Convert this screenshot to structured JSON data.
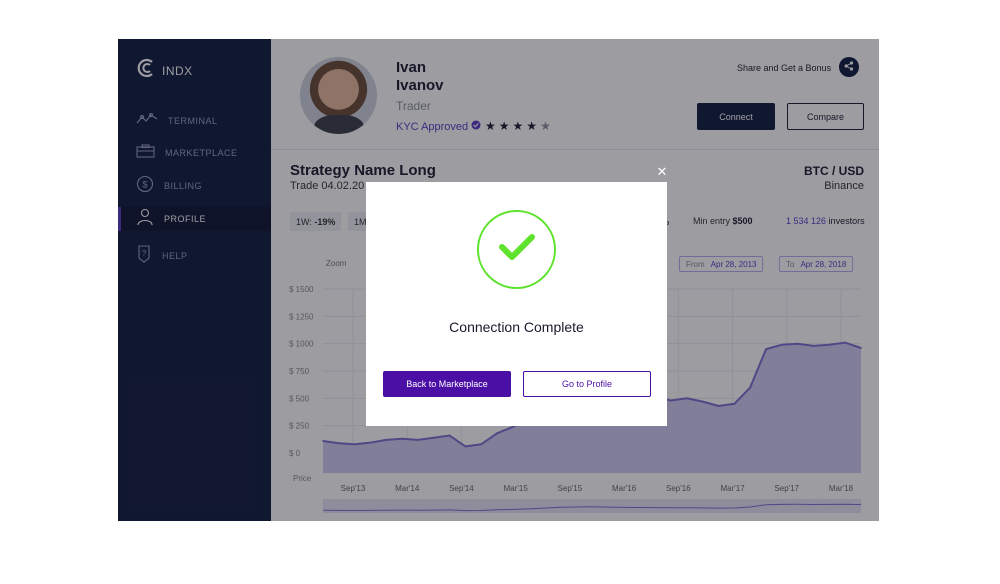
{
  "brand": {
    "name": "INDX"
  },
  "sidebar": {
    "items": [
      {
        "label": "TERMINAL",
        "icon": "terminal-icon",
        "active": false
      },
      {
        "label": "MARKETPLACE",
        "icon": "briefcase-icon",
        "active": false
      },
      {
        "label": "BILLING",
        "icon": "dollar-icon",
        "active": false
      },
      {
        "label": "PROFILE",
        "icon": "user-icon",
        "active": true
      },
      {
        "label": "HELP",
        "icon": "help-icon",
        "active": false
      }
    ]
  },
  "profile": {
    "first_name": "Ivan",
    "last_name": "Ivanov",
    "role": "Trader",
    "kyc": "KYC Approved",
    "rating": 4,
    "rating_max": 5
  },
  "header": {
    "share_label": "Share and Get a Bonus",
    "connect_label": "Connect",
    "compare_label": "Compare"
  },
  "strategy": {
    "title": "Strategy Name Long",
    "trade_date": "Trade 04.02.20",
    "pair": "BTC / USD",
    "exchange": "Binance",
    "stats": [
      {
        "label": "1W:",
        "value": "-19%"
      },
      {
        "label": "1M",
        "value": ""
      }
    ],
    "stat_tail": "%",
    "min_entry_label": "Min entry",
    "min_entry_value": "$500",
    "investors_count": "1 534 126",
    "investors_label": "investors"
  },
  "chart_controls": {
    "zoom_label": "Zoom",
    "from_label": "From",
    "from_value": "Apr 28, 2013",
    "to_label": "To",
    "to_value": "Apr 28, 2018"
  },
  "chart_data": {
    "type": "area",
    "ylabel": "Price",
    "y_ticks": [
      "$ 1500",
      "$ 1250",
      "$ 1000",
      "$ 750",
      "$ 500",
      "$ 250",
      "$ 0"
    ],
    "ylim": [
      0,
      1500
    ],
    "x_ticks": [
      "Sep'13",
      "Mar'14",
      "Sep'14",
      "Mar'15",
      "Sep'15",
      "Mar'16",
      "Sep'16",
      "Mar'17",
      "Sep'17",
      "Mar'18"
    ],
    "series": [
      {
        "values": [
          110,
          90,
          80,
          95,
          120,
          130,
          120,
          140,
          160,
          60,
          80,
          180,
          240,
          320,
          430,
          560,
          600,
          640,
          580,
          540,
          520,
          510,
          480,
          500,
          470,
          430,
          450,
          600,
          950,
          990,
          1000,
          980,
          990,
          1010,
          960
        ]
      }
    ],
    "color": "#7b6fd0"
  },
  "modal": {
    "title": "Connection Complete",
    "primary_label": "Back to Marketplace",
    "secondary_label": "Go to Profile",
    "close_icon": "close-icon",
    "success_color": "#5ee32d",
    "primary_color": "#4b0fa6"
  }
}
